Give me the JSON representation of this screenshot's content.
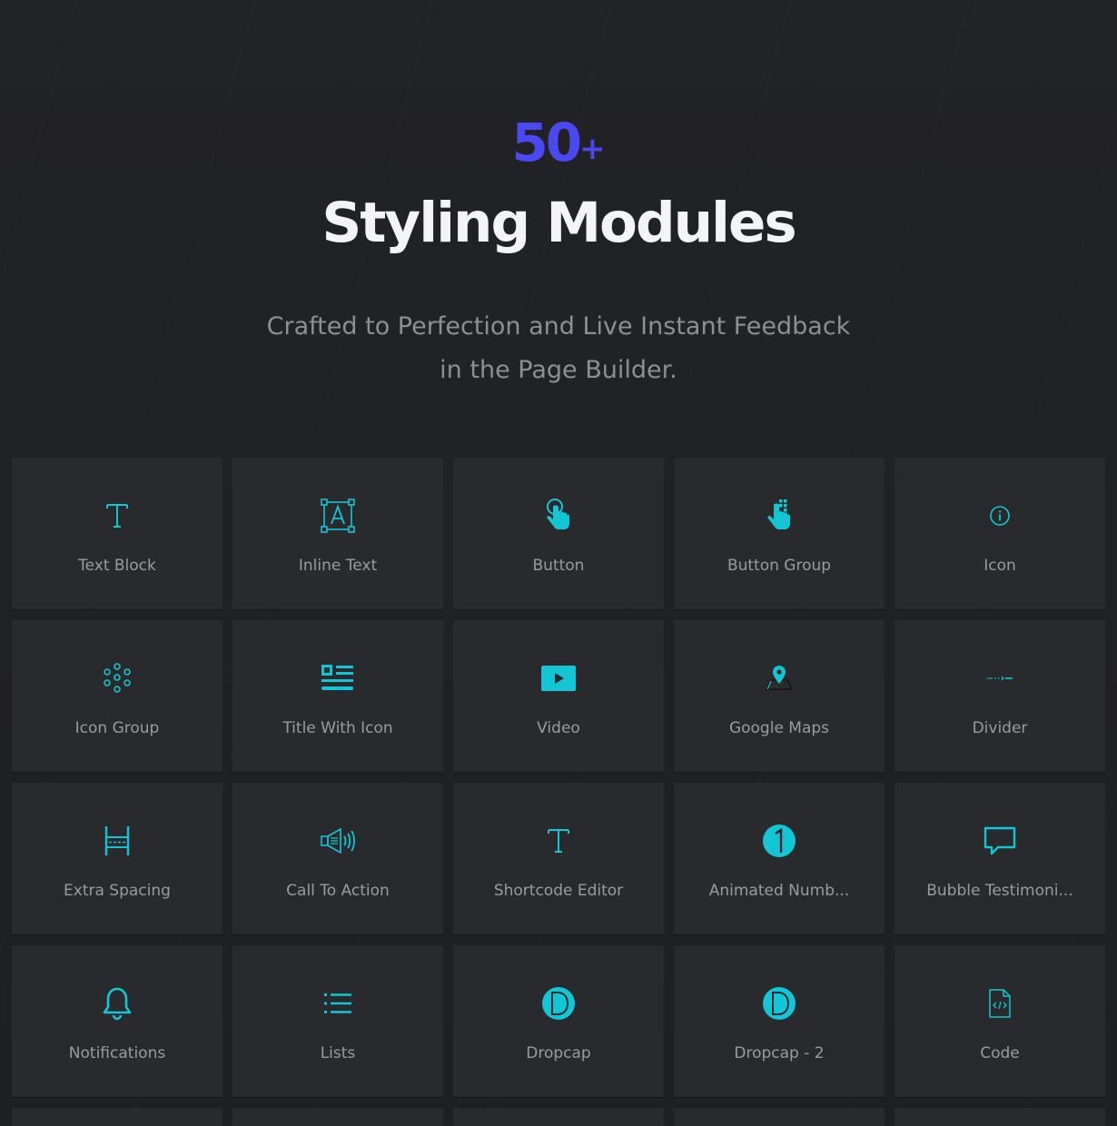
{
  "hero": {
    "count": "50",
    "count_suffix": "+",
    "title": "Styling Modules",
    "subtitle_line1": "Crafted to Perfection and Live Instant Feedback",
    "subtitle_line2": "in the Page Builder."
  },
  "colors": {
    "accent": "#13c6d6",
    "count": "#4a48f0",
    "background": "#1f2023",
    "tile": "#292a2d"
  },
  "modules": [
    {
      "label": "Text Block",
      "icon": "text-t-icon"
    },
    {
      "label": "Inline Text",
      "icon": "inline-text-icon"
    },
    {
      "label": "Button",
      "icon": "pointer-hand-icon"
    },
    {
      "label": "Button Group",
      "icon": "hand-grid-icon"
    },
    {
      "label": "Icon",
      "icon": "info-circle-icon"
    },
    {
      "label": "Icon Group",
      "icon": "circle-cluster-icon"
    },
    {
      "label": "Title With Icon",
      "icon": "title-icon-icon"
    },
    {
      "label": "Video",
      "icon": "video-play-icon"
    },
    {
      "label": "Google Maps",
      "icon": "map-pin-icon"
    },
    {
      "label": "Divider",
      "icon": "divider-icon"
    },
    {
      "label": "Extra Spacing",
      "icon": "spacing-icon"
    },
    {
      "label": "Call To Action",
      "icon": "megaphone-icon"
    },
    {
      "label": "Shortcode Editor",
      "icon": "text-t-icon"
    },
    {
      "label": "Animated Numb...",
      "icon": "number-one-icon"
    },
    {
      "label": "Bubble Testimoni...",
      "icon": "speech-bubble-icon"
    },
    {
      "label": "Notifications",
      "icon": "bell-icon"
    },
    {
      "label": "Lists",
      "icon": "list-icon"
    },
    {
      "label": "Dropcap",
      "icon": "dropcap-d-icon"
    },
    {
      "label": "Dropcap - 2",
      "icon": "dropcap-d-icon"
    },
    {
      "label": "Code",
      "icon": "code-file-icon"
    }
  ]
}
